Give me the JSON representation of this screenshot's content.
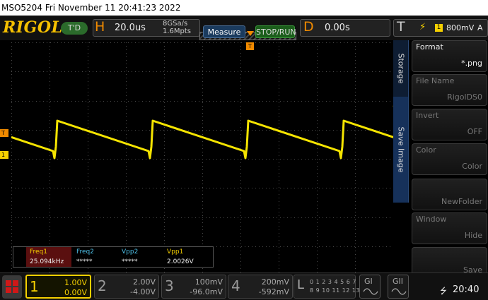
{
  "title": "MSO5204  Fri November 11 20:41:23 2022",
  "brand": "RIGOL",
  "status": "T'D",
  "horizontal": {
    "letter": "H",
    "scale": "20.0us",
    "sample_rate": "8GSa/s",
    "memory_depth": "1.6Mpts"
  },
  "buttons": {
    "measure": "Measure",
    "stop_run": "STOP/RUN"
  },
  "delay": {
    "letter": "D",
    "value": "0.00s"
  },
  "trigger": {
    "letter": "T",
    "edge_icon": "rising-edge-icon",
    "source": "1",
    "level": "800mV",
    "mode": "A"
  },
  "markers": {
    "trigger": "T",
    "ch1": "1"
  },
  "measurements": [
    {
      "name": "Freq1",
      "value": "25.094kHz",
      "color": "#f5d000"
    },
    {
      "name": "Freq2",
      "value": "*****",
      "color": "#4ec0e8"
    },
    {
      "name": "Vpp2",
      "value": "*****",
      "color": "#4ec0e8"
    },
    {
      "name": "Vpp1",
      "value": "2.0026V",
      "color": "#f5d000"
    }
  ],
  "side_tabs": {
    "storage": "Storage",
    "save_image": "Save Image"
  },
  "menu": [
    {
      "label": "Format",
      "value": "*.png",
      "enabled": true
    },
    {
      "label": "File Name",
      "value": "RigolDS0",
      "enabled": false
    },
    {
      "label": "Invert",
      "value": "OFF",
      "enabled": false
    },
    {
      "label": "Color",
      "value": "Color",
      "enabled": false
    },
    {
      "label": "",
      "value": "NewFolder",
      "enabled": false
    },
    {
      "label": "Window",
      "value": "Hide",
      "enabled": false
    },
    {
      "label": "",
      "value": "Save",
      "enabled": false
    }
  ],
  "channels": [
    {
      "num": "1",
      "coupling": "",
      "scale": "1.00V",
      "offset": "0.00V",
      "color": "#f5d000"
    },
    {
      "num": "2",
      "coupling": "",
      "scale": "2.00V",
      "offset": "-4.00V",
      "color": "#999999"
    },
    {
      "num": "3",
      "coupling": "",
      "scale": "100mV",
      "offset": "-96.0mV",
      "color": "#999999"
    },
    {
      "num": "4",
      "coupling": "",
      "scale": "200mV",
      "offset": "-592mV",
      "color": "#999999"
    }
  ],
  "logic": {
    "letter": "L",
    "row1": "0 1 2 3 4 5 6 7",
    "row2": "8 9 10 11 12 13 14 15"
  },
  "generators": [
    "GI",
    "GII"
  ],
  "clock": "20:40",
  "colors": {
    "ch1": "#f5d000",
    "accent": "#f08a00",
    "grid": "#5a5a5a",
    "trace": "#f5e400"
  }
}
